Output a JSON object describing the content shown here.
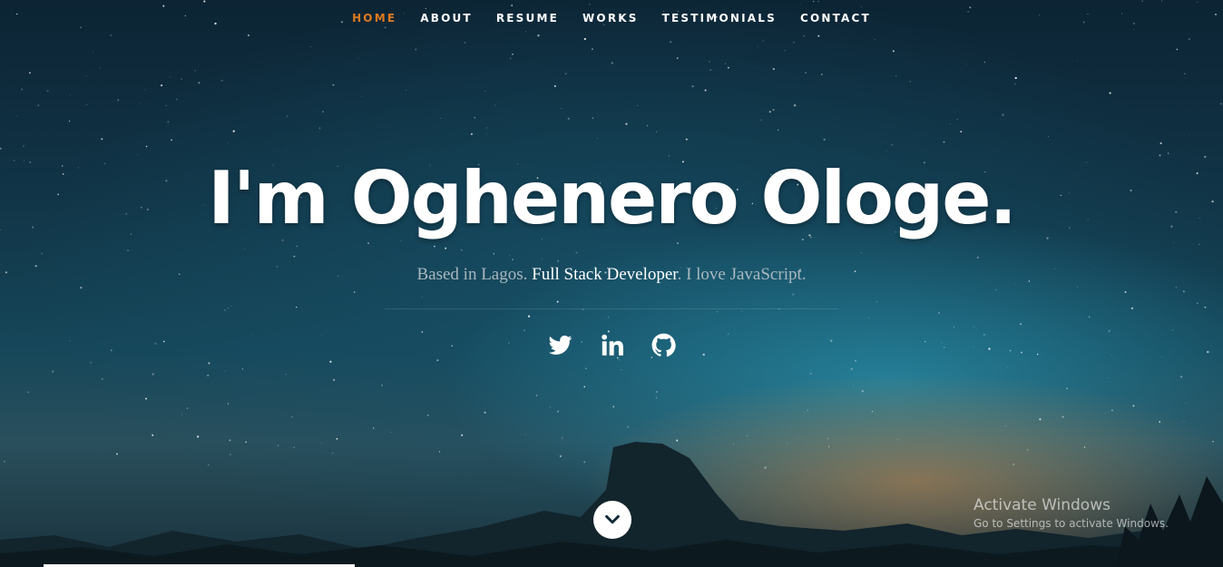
{
  "nav": {
    "items": [
      {
        "label": "HOME",
        "active": true
      },
      {
        "label": "ABOUT",
        "active": false
      },
      {
        "label": "RESUME",
        "active": false
      },
      {
        "label": "WORKS",
        "active": false
      },
      {
        "label": "TESTIMONIALS",
        "active": false
      },
      {
        "label": "CONTACT",
        "active": false
      }
    ],
    "active_color": "#e07a1f"
  },
  "hero": {
    "headline": "I'm Oghenero Ologe.",
    "tagline_before": "Based in Lagos. ",
    "tagline_highlight": "Full Stack Developer",
    "tagline_after": ". I love JavaScript."
  },
  "social": {
    "icons": [
      "twitter-icon",
      "linkedin-icon",
      "github-icon"
    ]
  },
  "scroll_button": {
    "icon": "chevron-down-icon"
  },
  "watermark": {
    "title": "Activate Windows",
    "subtitle": "Go to Settings to activate Windows."
  }
}
